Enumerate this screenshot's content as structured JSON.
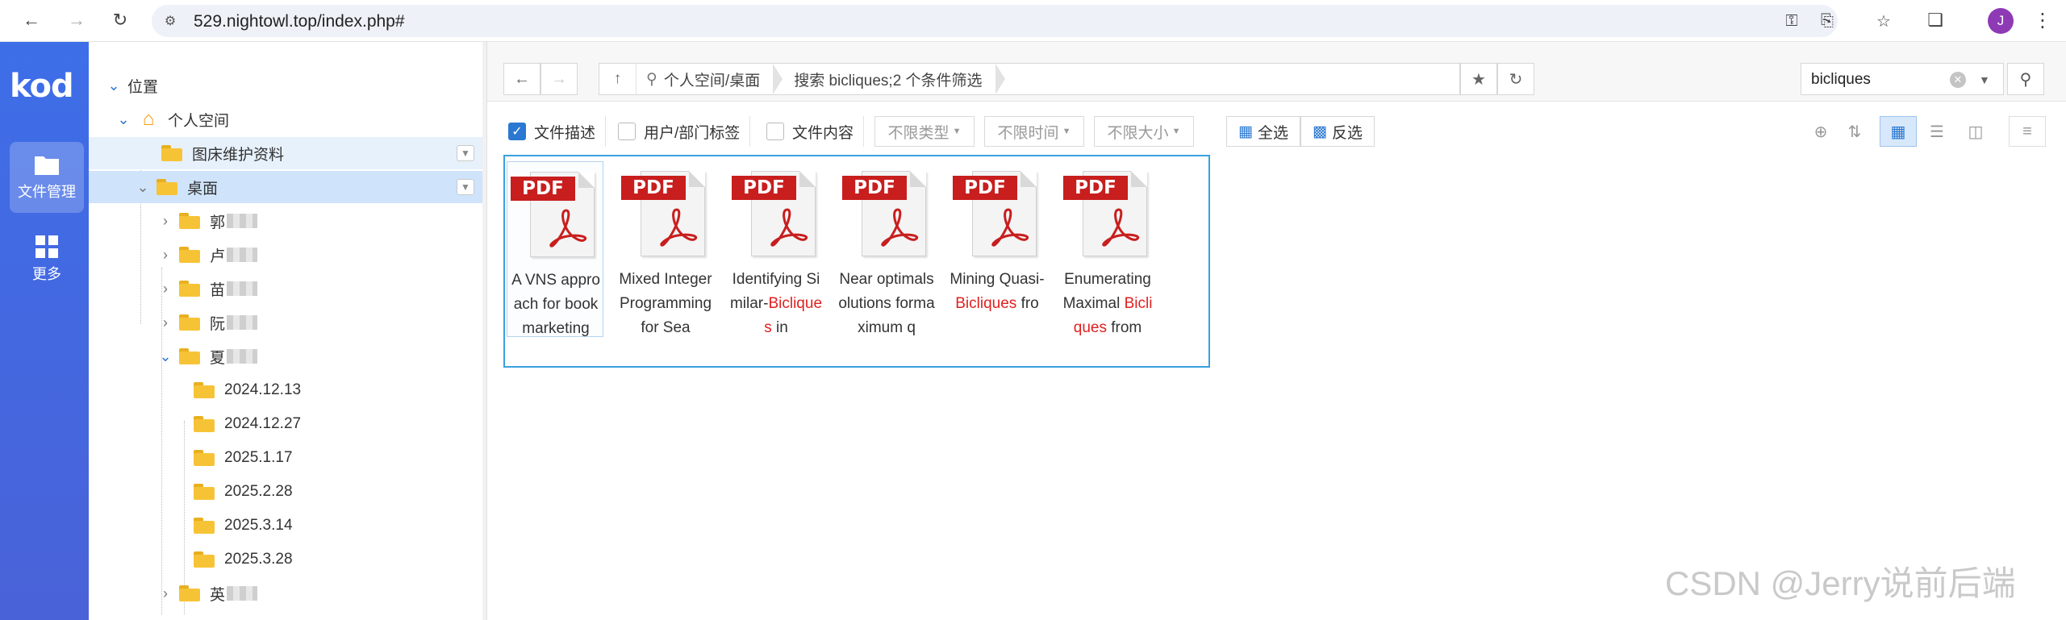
{
  "browser": {
    "url": "529.nightowl.top/index.php#",
    "profile_initial": "J",
    "icons": [
      "back-icon",
      "forward-icon",
      "reload-icon",
      "site-info-icon",
      "key-icon",
      "install-icon",
      "star-icon",
      "extensions-icon",
      "menu-icon"
    ]
  },
  "rail": {
    "logo": "kod",
    "items": [
      {
        "label": "文件管理",
        "icon": "folder-icon"
      },
      {
        "label": "更多",
        "icon": "grid-icon"
      }
    ]
  },
  "tree": {
    "root_label": "位置",
    "space_label": "个人空间",
    "items": [
      {
        "label": "图床维护资料"
      },
      {
        "label": "桌面"
      },
      {
        "label": "郭"
      },
      {
        "label": "卢"
      },
      {
        "label": "苗"
      },
      {
        "label": "阮"
      },
      {
        "label": "夏"
      },
      {
        "label": "2024.12.13"
      },
      {
        "label": "2024.12.27"
      },
      {
        "label": "2025.1.17"
      },
      {
        "label": "2025.2.28"
      },
      {
        "label": "2025.3.14"
      },
      {
        "label": "2025.3.28"
      },
      {
        "label": "英"
      }
    ]
  },
  "toolbar": {
    "breadcrumb": [
      "个人空间/桌面",
      "搜索 bicliques;2 个条件筛选"
    ],
    "search_value": "bicliques"
  },
  "filters": {
    "file_desc": "文件描述",
    "user_tag": "用户/部门标签",
    "file_content": "文件内容",
    "type": "不限类型",
    "time": "不限时间",
    "size": "不限大小",
    "select_all": "全选",
    "invert": "反选"
  },
  "files": [
    {
      "badge": "PDF",
      "parts": [
        {
          "t": "A VNS appr"
        },
        {
          "t": "oach for boo"
        },
        {
          "t": "k marketing"
        }
      ]
    },
    {
      "badge": "PDF",
      "parts": [
        {
          "t": "Mixed Integ"
        },
        {
          "t": "er Program"
        },
        {
          "t": "ming for Sea"
        }
      ]
    },
    {
      "badge": "PDF",
      "parts": [
        {
          "t": "Identifying S"
        },
        {
          "t": "imilar-"
        },
        {
          "t": "Bicliques",
          "h": true
        },
        {
          "t": " in"
        }
      ]
    },
    {
      "badge": "PDF",
      "parts": [
        {
          "t": "Near optimal"
        },
        {
          "t": "solutions for"
        },
        {
          "t": "maximum q"
        }
      ]
    },
    {
      "badge": "PDF",
      "parts": [
        {
          "t": "Mining Quas"
        },
        {
          "t": "i-"
        },
        {
          "t": "Bicliques",
          "h": true
        },
        {
          "t": " fro"
        }
      ]
    },
    {
      "badge": "PDF",
      "parts": [
        {
          "t": "Enumerating"
        },
        {
          "t": "Maximal "
        },
        {
          "t": "Bic",
          "h": true
        },
        {
          "t": "liques",
          "h": true
        },
        {
          "t": " from"
        }
      ]
    }
  ],
  "watermark": "CSDN @Jerry说前后端"
}
